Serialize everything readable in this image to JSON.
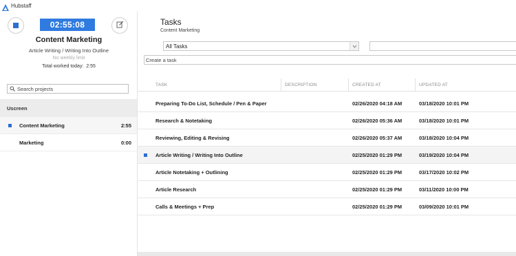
{
  "app": {
    "title": "Hubstaff"
  },
  "timer": {
    "elapsed": "02:55:08",
    "project": "Content Marketing",
    "task": "Article Writing / Writing Into Outline",
    "weekly_limit": "No weekly limit",
    "total_label": "Total worked today:",
    "total_value": "2:55"
  },
  "sidebar": {
    "search_placeholder": "Search projects",
    "organization": "Uscreen",
    "projects": [
      {
        "name": "Content Marketing",
        "time": "2:55",
        "active": true
      },
      {
        "name": "Marketing",
        "time": "0:00",
        "active": false
      }
    ]
  },
  "main": {
    "title": "Tasks",
    "subtitle": "Content Marketing",
    "filter_selected": "All Tasks",
    "filter_input_value": "",
    "create_placeholder": "Create a task",
    "columns": [
      "TASK",
      "DESCRIPTION",
      "CREATED AT",
      "UPDATED AT"
    ],
    "tasks": [
      {
        "task": "Preparing To-Do List, Schedule / Pen & Paper",
        "description": "",
        "created": "02/26/2020 04:18 AM",
        "updated": "03/18/2020 10:01 PM",
        "active": false
      },
      {
        "task": "Research & Notetaking",
        "description": "",
        "created": "02/26/2020 05:36 AM",
        "updated": "03/18/2020 10:01 PM",
        "active": false
      },
      {
        "task": "Reviewing, Editing & Revising",
        "description": "",
        "created": "02/26/2020 05:37 AM",
        "updated": "03/18/2020 10:04 PM",
        "active": false
      },
      {
        "task": "Article Writing / Writing Into Outline",
        "description": "",
        "created": "02/25/2020 01:29 PM",
        "updated": "03/19/2020 10:04 PM",
        "active": true
      },
      {
        "task": "Article Notetaking + Outlining",
        "description": "",
        "created": "02/25/2020 01:29 PM",
        "updated": "03/17/2020 10:02 PM",
        "active": false
      },
      {
        "task": "Article Research",
        "description": "",
        "created": "02/25/2020 01:29 PM",
        "updated": "03/11/2020 10:00 PM",
        "active": false
      },
      {
        "task": "Calls & Meetings + Prep",
        "description": "",
        "created": "02/25/2020 01:29 PM",
        "updated": "03/09/2020 10:01 PM",
        "active": false
      }
    ]
  },
  "colors": {
    "accent": "#2f7be0",
    "active_row": "#f4f4f4",
    "org_row": "#ececec"
  },
  "icons": {
    "logo": "hubstaff-logo-icon",
    "stop": "stop-icon",
    "edit": "edit-icon",
    "search": "search-icon",
    "dropdown": "chevron-down-icon",
    "active_marker": "active-marker-icon"
  }
}
